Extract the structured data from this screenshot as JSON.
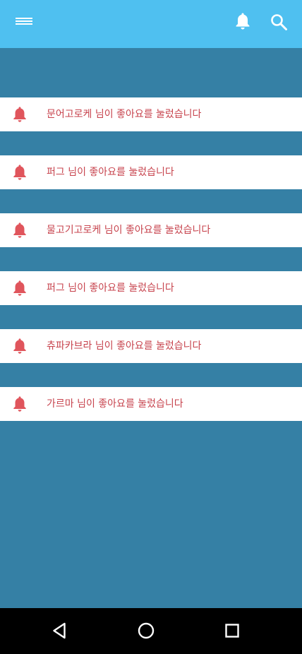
{
  "colors": {
    "app_bar": "#4fc0f0",
    "content_background": "#3580a5",
    "notification_text": "#c7434d",
    "notification_icon": "#e0555c",
    "nav_bar": "#000000"
  },
  "app_bar": {
    "menu_icon": "hamburger-menu-icon",
    "notifications_icon": "bell-icon",
    "search_icon": "search-icon"
  },
  "notifications": [
    {
      "icon": "bell-icon",
      "text": "문어고로케 님이 좋아요를 눌렀습니다"
    },
    {
      "icon": "bell-icon",
      "text": "퍼그 님이 좋아요를 눌렀습니다"
    },
    {
      "icon": "bell-icon",
      "text": "물고기고로케 님이 좋아요를 눌렀습니다"
    },
    {
      "icon": "bell-icon",
      "text": "퍼그 님이 좋아요를 눌렀습니다"
    },
    {
      "icon": "bell-icon",
      "text": "츄파카브라 님이 좋아요를 눌렀습니다"
    },
    {
      "icon": "bell-icon",
      "text": "가르마 님이 좋아요를 눌렀습니다"
    }
  ],
  "nav_bar": {
    "back_icon": "triangle-back-icon",
    "home_icon": "circle-home-icon",
    "recent_icon": "square-recent-apps-icon"
  }
}
